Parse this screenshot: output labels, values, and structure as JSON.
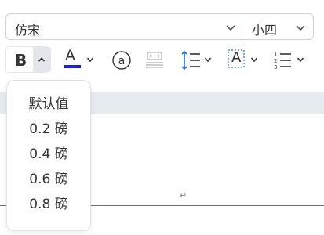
{
  "font": {
    "family_label": "仿宋",
    "size_label": "小四"
  },
  "toolbar": {
    "bold_label": "B",
    "font_color_label": "A",
    "font_color_swatch": "#1f1fd6",
    "highlight_label": "A"
  },
  "border_width_menu": {
    "items": [
      {
        "label": "默认值"
      },
      {
        "label": "0.2 磅"
      },
      {
        "label": "0.4 磅"
      },
      {
        "label": "0.6 磅"
      },
      {
        "label": "0.8 磅"
      }
    ]
  },
  "document": {
    "paragraph_mark": "↵"
  }
}
